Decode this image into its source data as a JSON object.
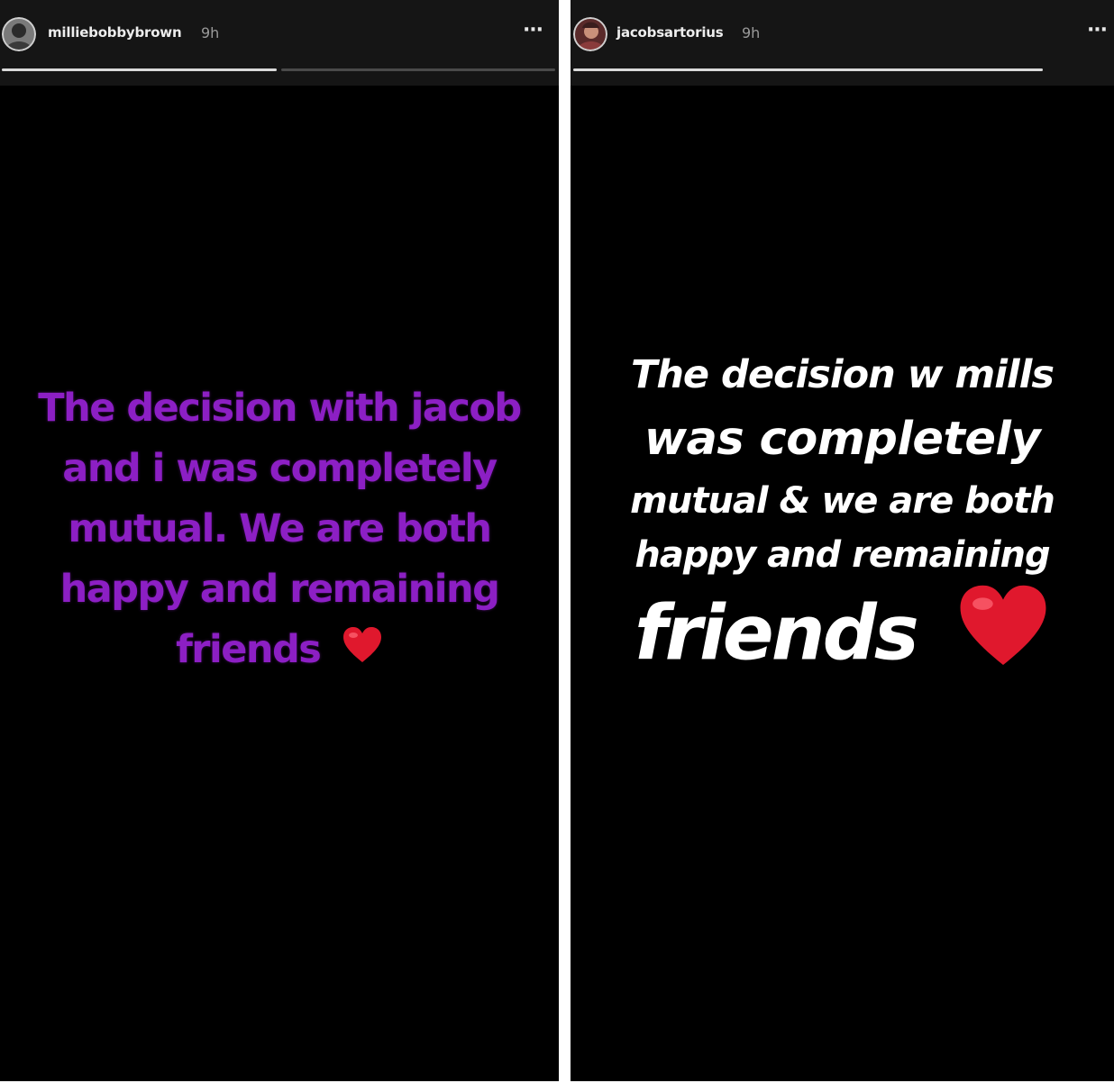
{
  "stories": [
    {
      "username": "milliebobbybrown",
      "time": "9h",
      "more_label": "···",
      "progress_segments": [
        1,
        0
      ],
      "caption_lines": [
        "The decision with jacob",
        "and i was completely",
        "mutual. We are both",
        "happy and remaining",
        "friends"
      ],
      "caption_color": "#8c1fc4",
      "heart_icon": "red-heart-emoji"
    },
    {
      "username": "jacobsartorius",
      "time": "9h",
      "more_label": "···",
      "progress_segments": [
        1
      ],
      "caption_lines": [
        "The decision w mills",
        "was completely",
        "mutual & we are both",
        "happy and remaining",
        "friends"
      ],
      "caption_color": "#ffffff",
      "heart_icon": "red-heart-emoji"
    }
  ]
}
